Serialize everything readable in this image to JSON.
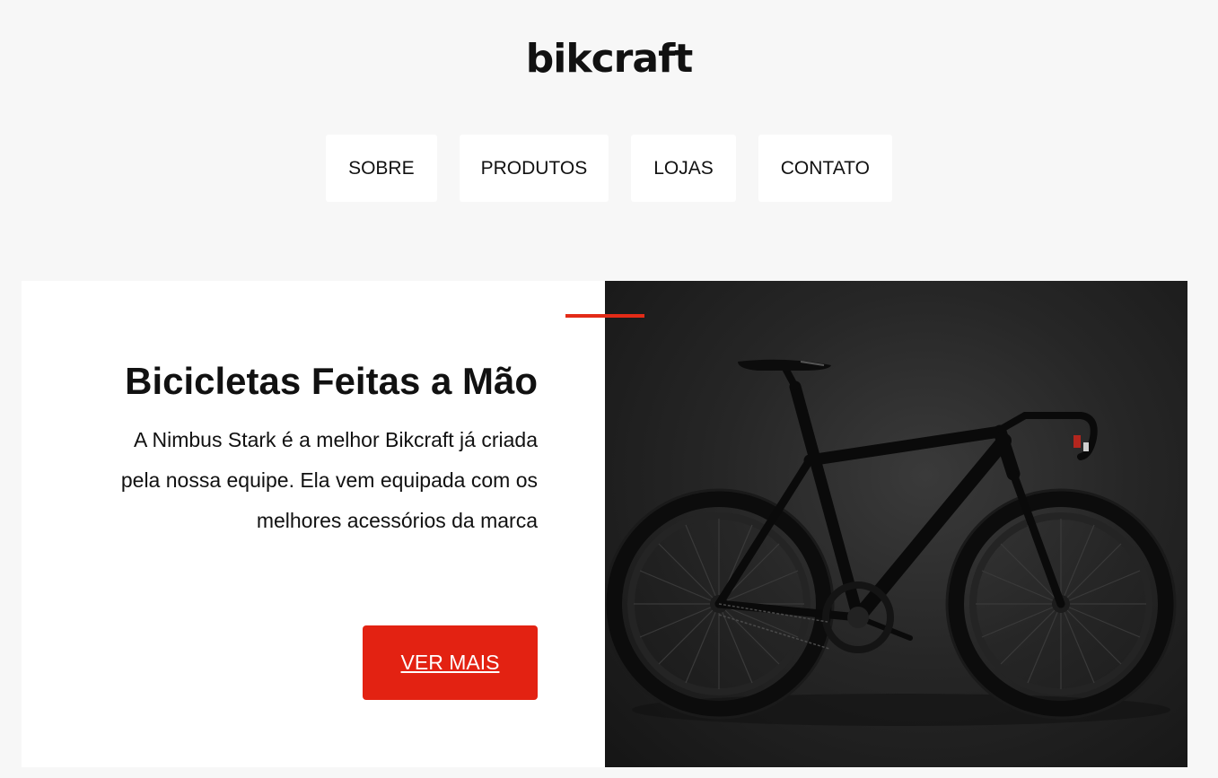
{
  "header": {
    "logo": "bikcraft"
  },
  "nav": {
    "items": [
      {
        "label": "SOBRE"
      },
      {
        "label": "PRODUTOS"
      },
      {
        "label": "LOJAS"
      },
      {
        "label": "CONTATO"
      }
    ]
  },
  "hero": {
    "title": "Bicicletas Feitas a Mão",
    "description": "A Nimbus Stark é a melhor Bikcraft já criada pela nossa equipe. Ela vem equipada com os melhores acessórios da marca",
    "cta_label": "VER MAIS",
    "image_icon": "black-road-bike"
  },
  "colors": {
    "accent": "#e32212",
    "background": "#f7f7f7",
    "card": "#ffffff",
    "text": "#111111"
  }
}
